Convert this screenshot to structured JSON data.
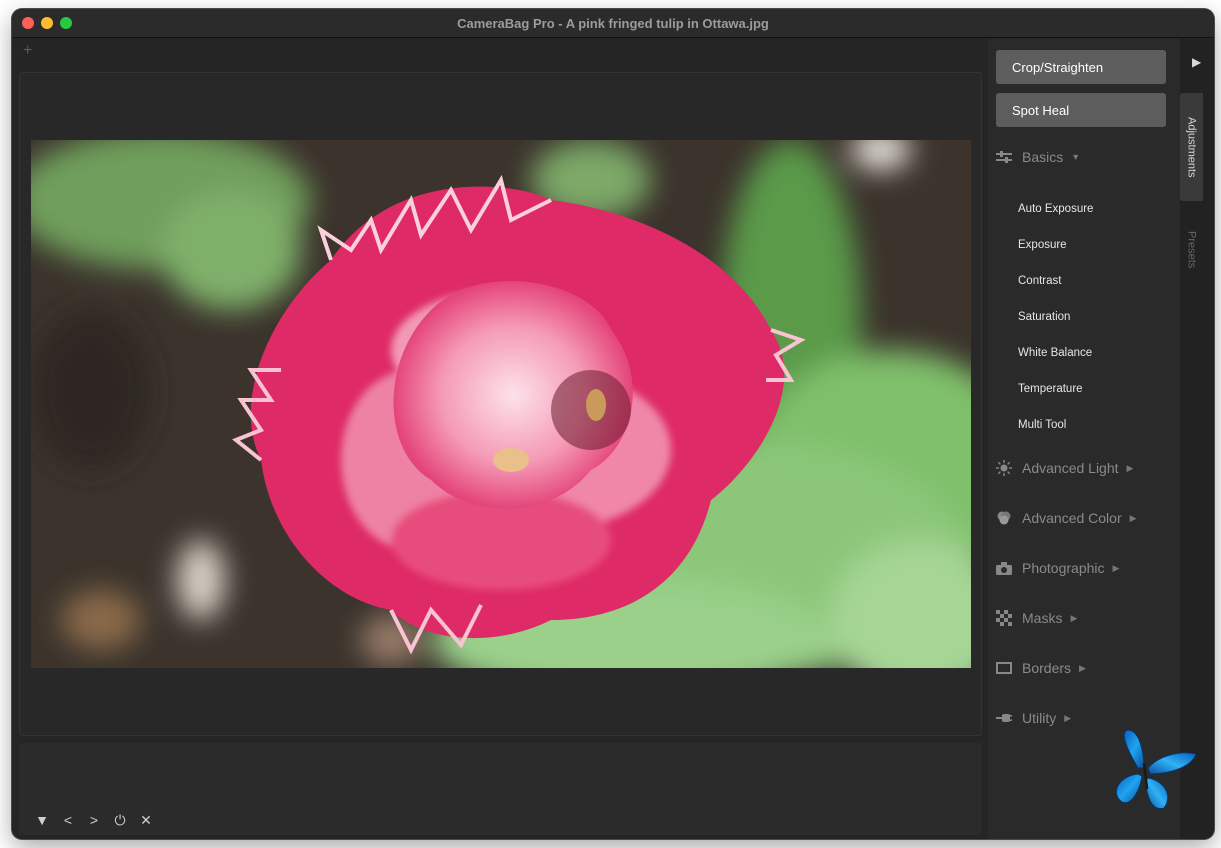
{
  "window": {
    "title": "CameraBag Pro - A pink fringed tulip in Ottawa.jpg"
  },
  "tabs": {
    "add_symbol": "+"
  },
  "tools": {
    "crop_label": "Crop/Straighten",
    "spot_heal_label": "Spot Heal"
  },
  "basics": {
    "label": "Basics",
    "items": [
      "Auto Exposure",
      "Exposure",
      "Contrast",
      "Saturation",
      "White Balance",
      "Temperature",
      "Multi Tool"
    ]
  },
  "sections": [
    {
      "label": "Advanced Light",
      "icon": "sun-icon"
    },
    {
      "label": "Advanced Color",
      "icon": "color-circles-icon"
    },
    {
      "label": "Photographic",
      "icon": "camera-icon"
    },
    {
      "label": "Masks",
      "icon": "checkerboard-icon"
    },
    {
      "label": "Borders",
      "icon": "rectangle-icon"
    },
    {
      "label": "Utility",
      "icon": "plug-icon"
    }
  ],
  "right_tabs": {
    "adjustments": "Adjustments",
    "presets": "Presets"
  },
  "filmstrip": {
    "collapse": "▼",
    "prev": "<",
    "next": ">",
    "power": "⏻",
    "close": "✕"
  },
  "colors": {
    "accent_pink": "#e0286a",
    "panel_bg": "#2a2a2a",
    "button_bg": "#5d5d5d"
  }
}
